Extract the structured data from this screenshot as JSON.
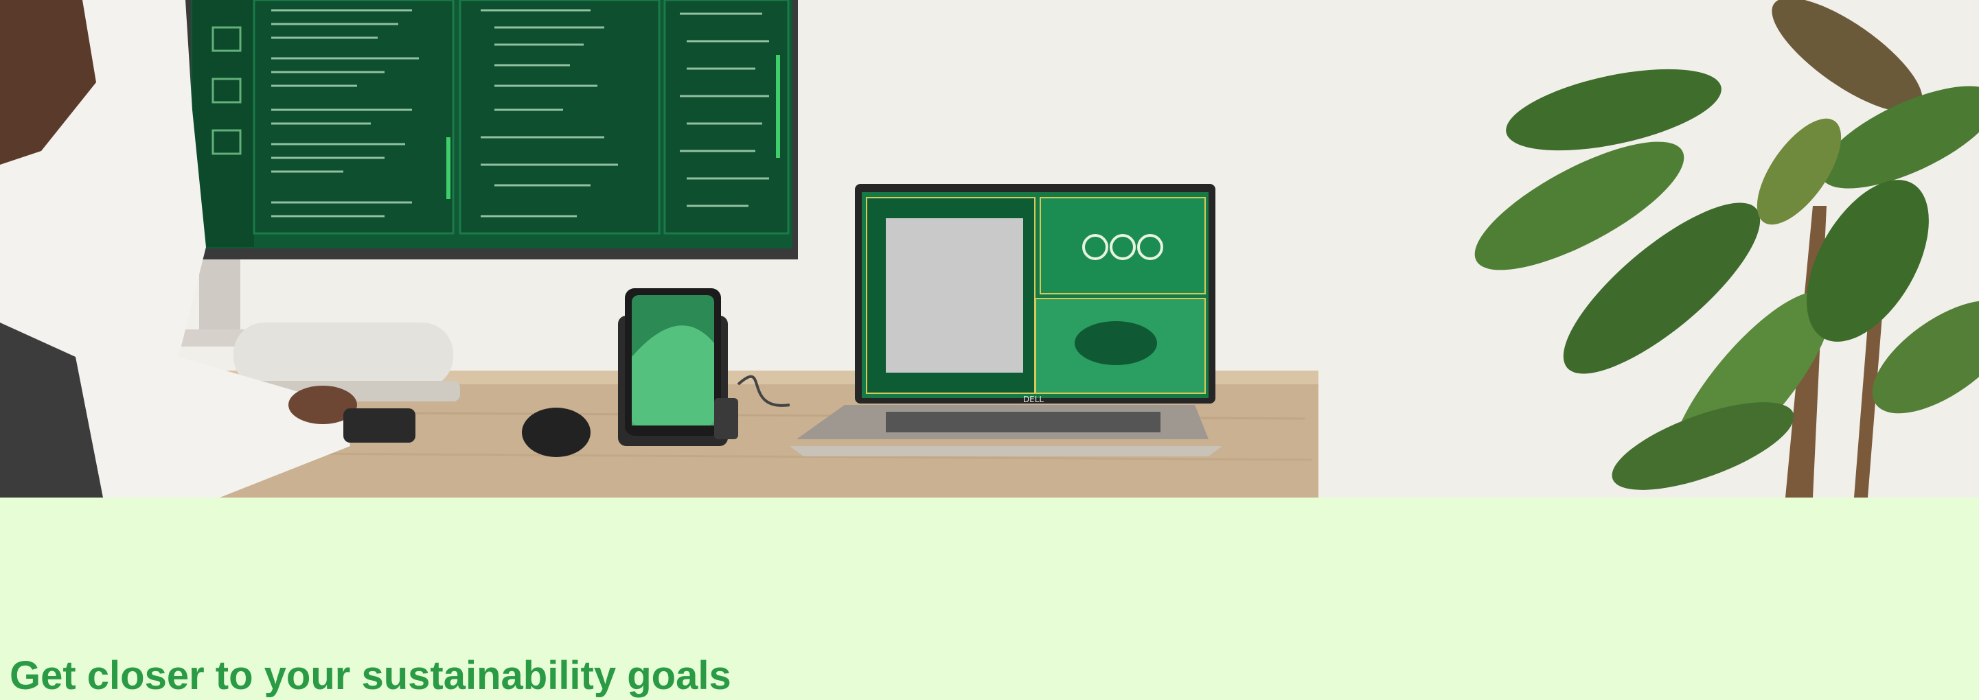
{
  "hero": {
    "image_description_icon": "hero-photo"
  },
  "section": {
    "heading": "Get closer to your sustainability goals"
  },
  "brand": {
    "laptop_logo": "DELL"
  },
  "colors": {
    "band_bg": "#e6fdd6",
    "heading_color": "#2a9a45",
    "screen_green": "#0f5a35"
  }
}
